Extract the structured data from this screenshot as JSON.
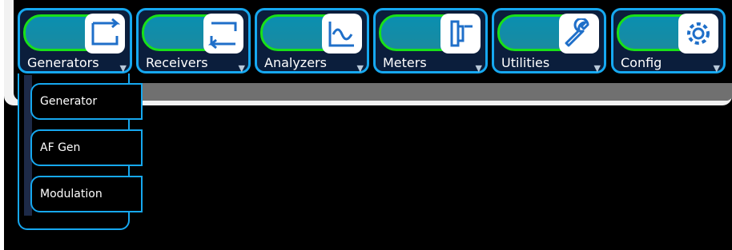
{
  "tabs": [
    {
      "label": "Generators",
      "icon": "generator-arrows-icon"
    },
    {
      "label": "Receivers",
      "icon": "receiver-arrows-icon"
    },
    {
      "label": "Analyzers",
      "icon": "waveform-icon"
    },
    {
      "label": "Meters",
      "icon": "meter-icon"
    },
    {
      "label": "Utilities",
      "icon": "wrench-icon"
    },
    {
      "label": "Config",
      "icon": "gear-icon"
    }
  ],
  "menu": {
    "items": [
      {
        "label": "Generator"
      },
      {
        "label": "AF Gen"
      },
      {
        "label": "Modulation"
      }
    ]
  },
  "colors": {
    "accent": "#16a8f0",
    "indicator": "#19e019",
    "background": "#000000",
    "grey_bar": "#707070"
  }
}
